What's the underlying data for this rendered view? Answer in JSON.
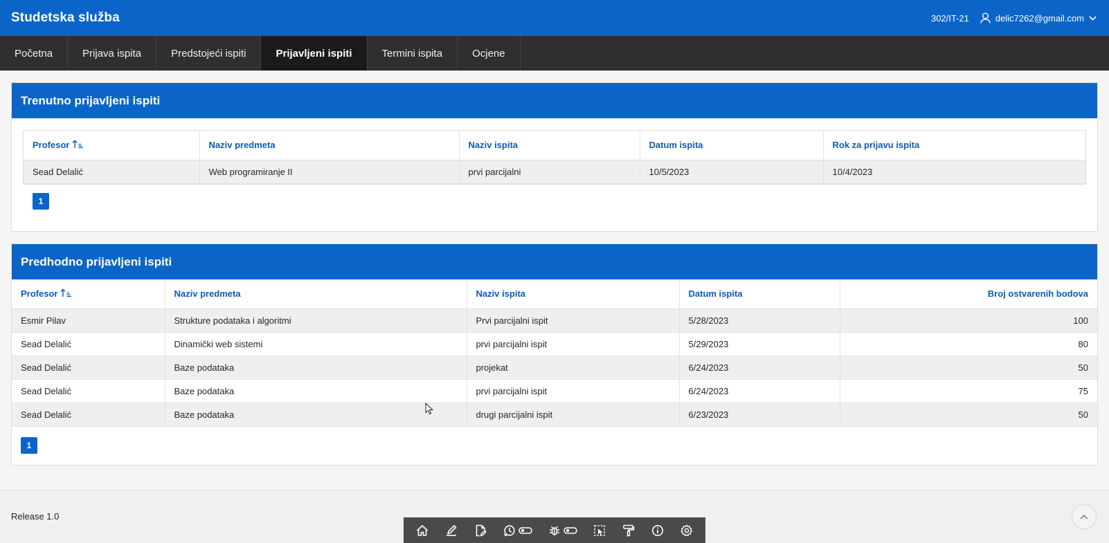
{
  "app": {
    "title": "Studetska služba"
  },
  "header": {
    "group": "302/IT-21",
    "user_email": "delic7262@gmail.com"
  },
  "nav": {
    "tabs": [
      {
        "label": "Početna"
      },
      {
        "label": "Prijava ispita"
      },
      {
        "label": "Predstojeći ispiti"
      },
      {
        "label": "Prijavljeni ispiti",
        "active": true
      },
      {
        "label": "Termini ispita"
      },
      {
        "label": "Ocjene"
      }
    ]
  },
  "current": {
    "title": "Trenutno prijavljeni ispiti",
    "columns": [
      "Profesor",
      "Naziv predmeta",
      "Naziv ispita",
      "Datum ispita",
      "Rok za prijavu ispita"
    ],
    "rows": [
      [
        "Sead Delalić",
        "Web programiranje II",
        "prvi parcijalni",
        "10/5/2023",
        "10/4/2023"
      ]
    ],
    "page": "1"
  },
  "previous": {
    "title": "Predhodno prijavljeni ispiti",
    "columns": [
      "Profesor",
      "Naziv predmeta",
      "Naziv ispita",
      "Datum ispita",
      "Broj ostvarenih bodova"
    ],
    "rows": [
      [
        "Esmir Pilav",
        "Strukture podataka i algoritmi",
        "Prvi parcijalni ispit",
        "5/28/2023",
        "100"
      ],
      [
        "Sead Delalić",
        "Dinamički web sistemi",
        "prvi parcijalni ispit",
        "5/29/2023",
        "80"
      ],
      [
        "Sead Delalić",
        "Baze podataka",
        "projekat",
        "6/24/2023",
        "50"
      ],
      [
        "Sead Delalić",
        "Baze podataka",
        "prvi parcijalni ispit",
        "6/24/2023",
        "75"
      ],
      [
        "Sead Delalić",
        "Baze podataka",
        "drugi parcijalni ispit",
        "6/23/2023",
        "50"
      ]
    ],
    "page": "1"
  },
  "footer": {
    "release": "Release 1.0"
  },
  "devbar_icons": [
    "home-icon",
    "edit-page-icon",
    "edit-file-icon",
    "session-icon",
    "debug-icon",
    "quick-edit-icon",
    "theme-roller-icon",
    "info-icon",
    "settings-icon"
  ]
}
